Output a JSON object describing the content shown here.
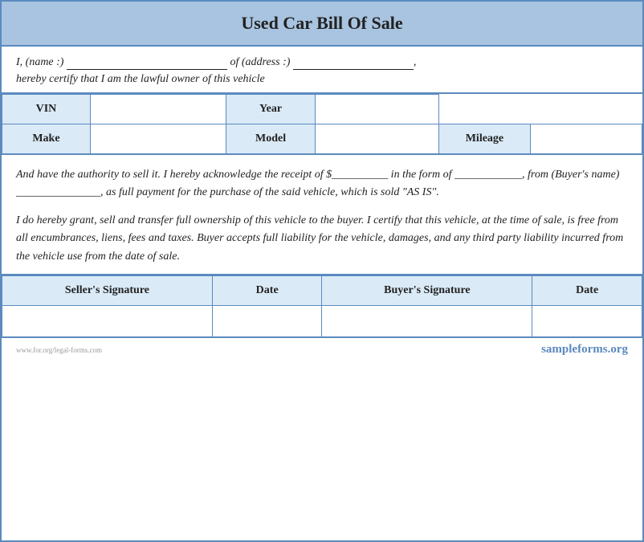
{
  "header": {
    "title": "Used Car Bill Of Sale"
  },
  "intro": {
    "line1": "I, (name :) _________________________ of (address :) _____________________,",
    "line2": "hereby certify that I am the lawful owner of this vehicle"
  },
  "vehicle_fields": {
    "row1": [
      {
        "label": "VIN",
        "label_id": "vin-label"
      },
      {
        "value": "",
        "value_id": "vin-value"
      },
      {
        "label": "Year",
        "label_id": "year-label"
      },
      {
        "value": "",
        "value_id": "year-value"
      }
    ],
    "row2": [
      {
        "label": "Make",
        "label_id": "make-label"
      },
      {
        "value": "",
        "value_id": "make-value"
      },
      {
        "label": "Model",
        "label_id": "model-label"
      },
      {
        "value": "",
        "value_id": "model-value"
      },
      {
        "label": "Mileage",
        "label_id": "mileage-label"
      },
      {
        "value": "",
        "value_id": "mileage-value"
      }
    ]
  },
  "body": {
    "paragraph1": "And have the authority to sell it. I hereby acknowledge the receipt of $__________ in the form of ____________, from (Buyer's name) _______________, as full payment for the purchase of the said vehicle, which is sold \"AS IS\".",
    "paragraph2": "I do hereby grant, sell and transfer full ownership of this vehicle to the buyer. I certify that this vehicle, at the time of sale, is free from all encumbrances, liens, fees and taxes. Buyer accepts full liability for the vehicle, damages, and any third party liability incurred from the vehicle use from the date of sale."
  },
  "signature": {
    "row_labels": [
      {
        "label": "Seller's Signature",
        "id": "seller-sig-label"
      },
      {
        "label": "Date",
        "id": "seller-date-label"
      },
      {
        "label": "Buyer's Signature",
        "id": "buyer-sig-label"
      },
      {
        "label": "Date",
        "id": "buyer-date-label"
      }
    ]
  },
  "footer": {
    "watermark": "www.for.org/legal-forms.com",
    "brand": "sampleforms.org"
  },
  "colors": {
    "header_bg": "#a8c4e0",
    "label_bg": "#daeaf7",
    "border": "#5b8abf"
  }
}
